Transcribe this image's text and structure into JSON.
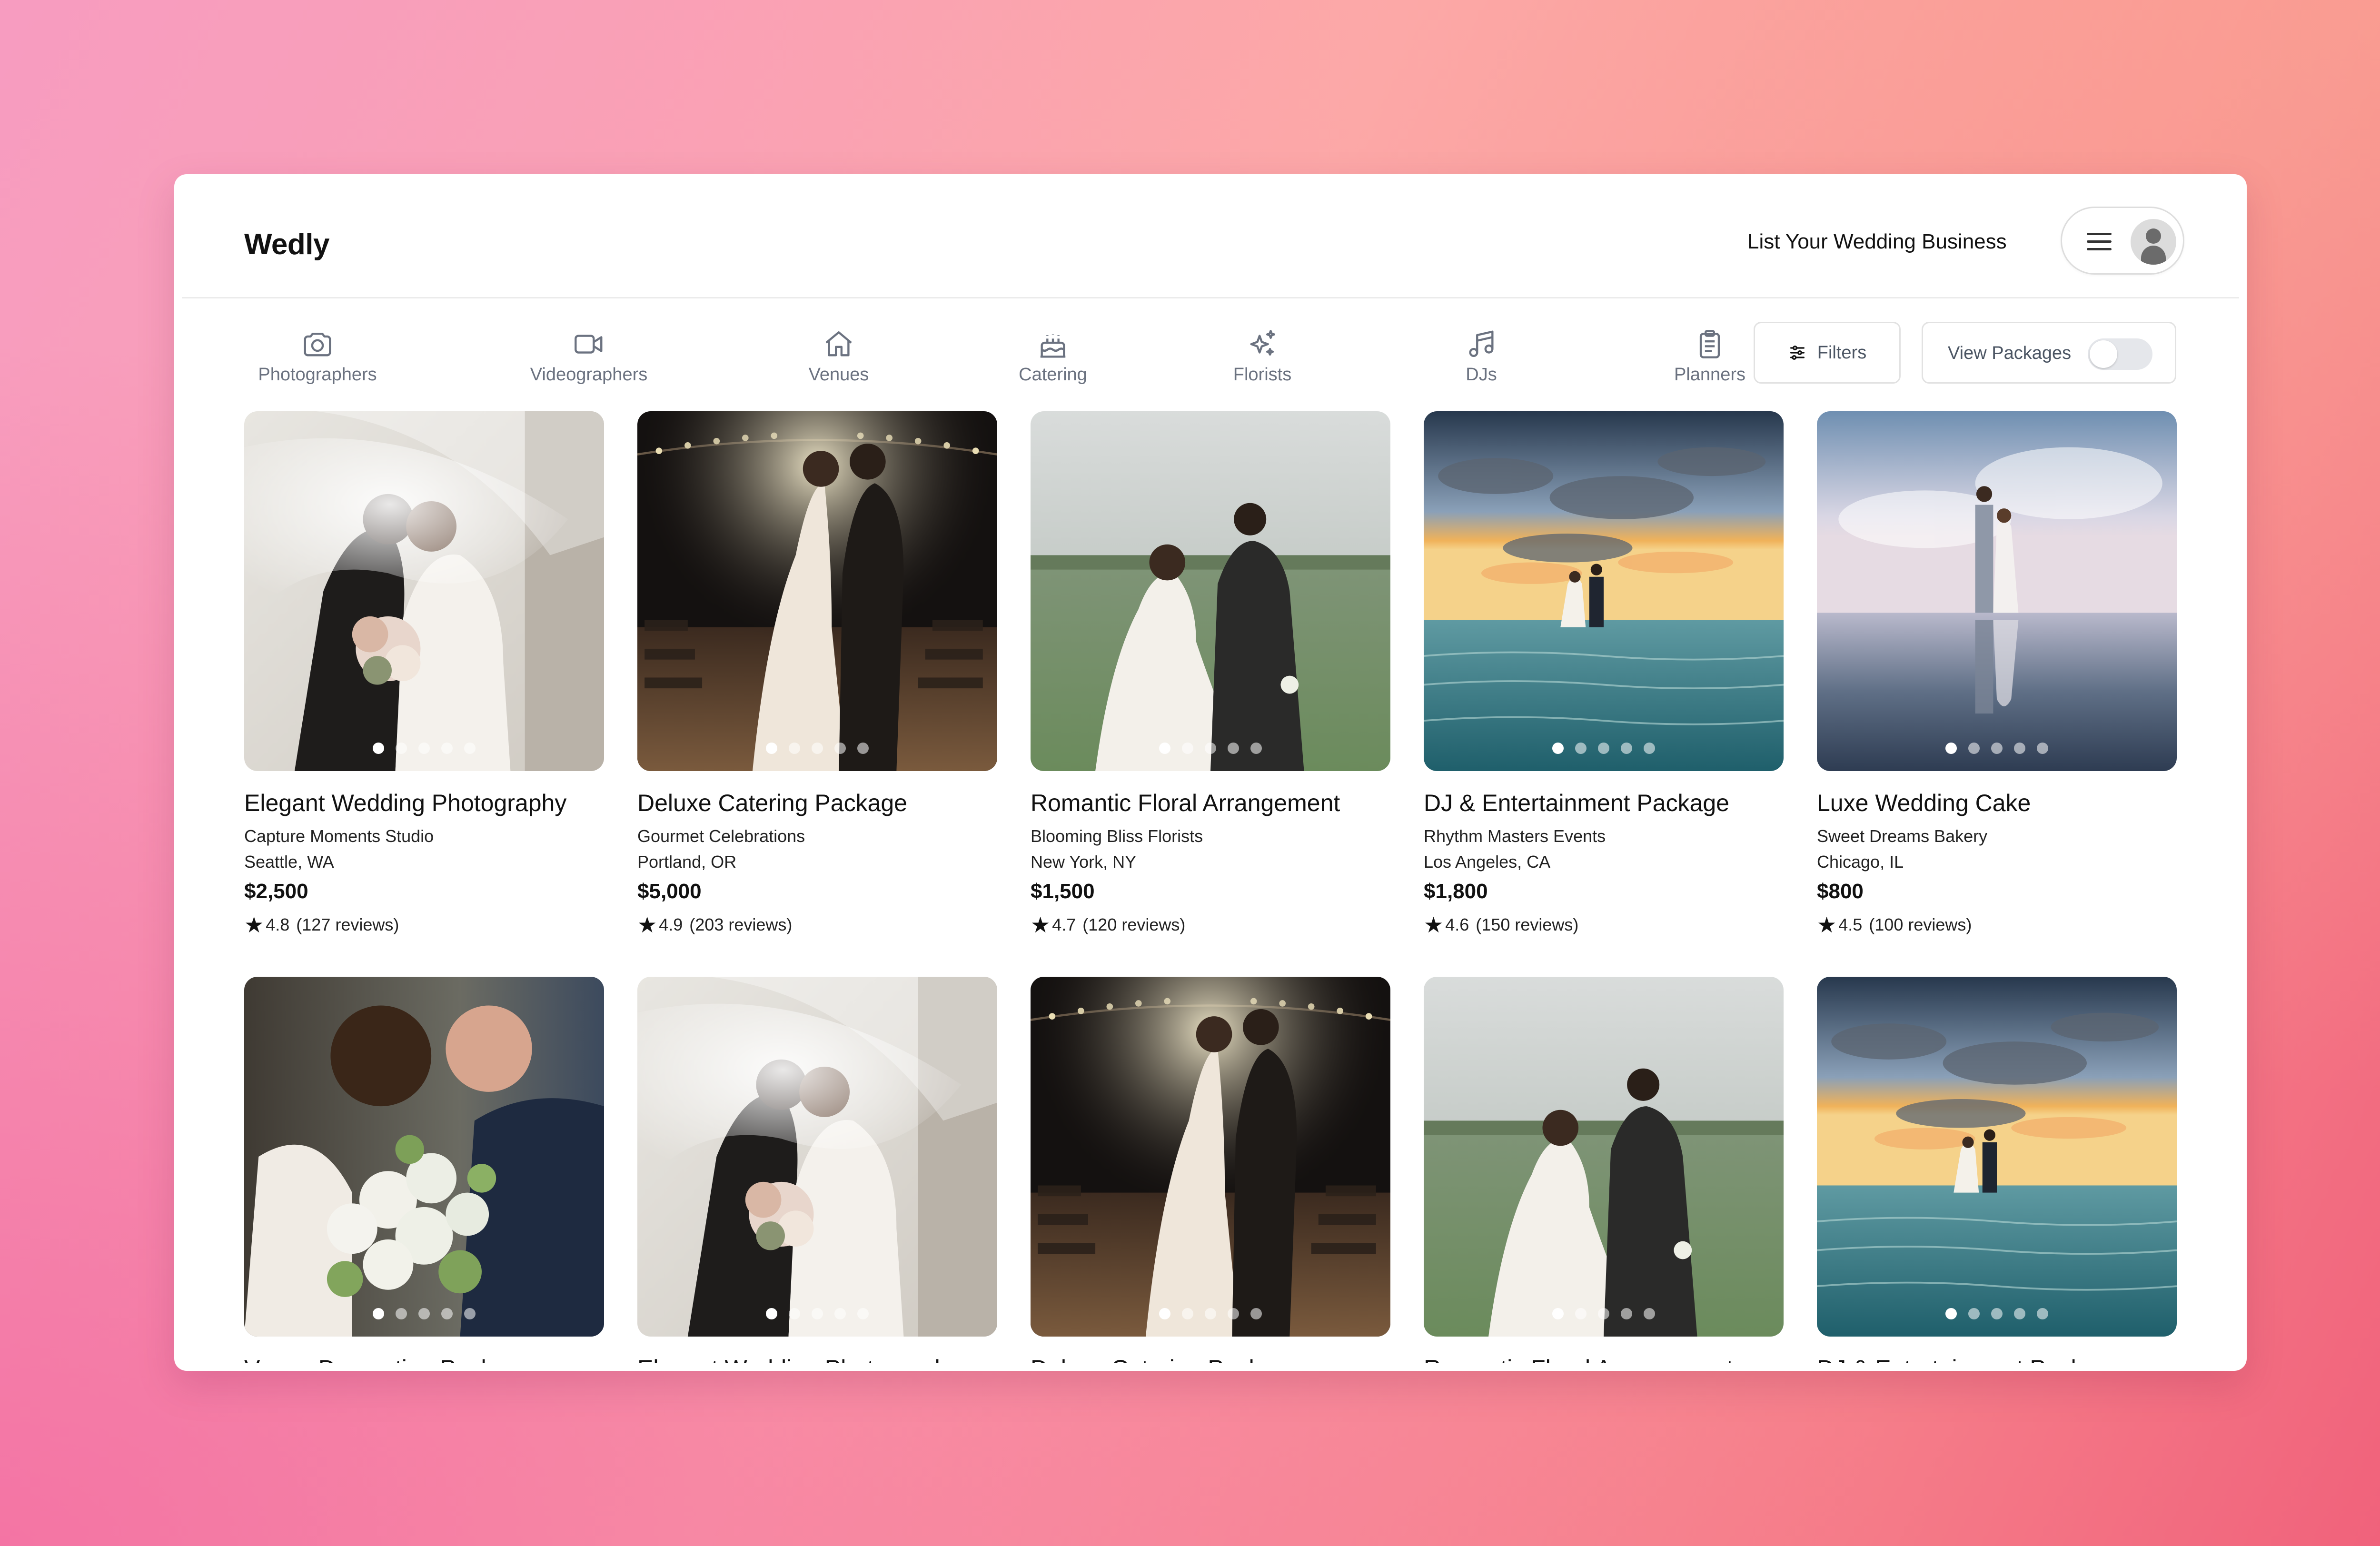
{
  "app": {
    "logo": "Wedly",
    "list_business": "List Your Wedding Business"
  },
  "user_menu": {
    "menu_icon": "hamburger-icon",
    "avatar_icon": "user-avatar-icon"
  },
  "categories": [
    {
      "label": "Photographers",
      "icon": "camera-icon"
    },
    {
      "label": "Videographers",
      "icon": "video-icon"
    },
    {
      "label": "Venues",
      "icon": "home-icon"
    },
    {
      "label": "Catering",
      "icon": "cake-icon"
    },
    {
      "label": "Florists",
      "icon": "sparkles-icon"
    },
    {
      "label": "DJs",
      "icon": "music-note-icon"
    },
    {
      "label": "Planners",
      "icon": "clipboard-icon"
    }
  ],
  "filters": {
    "label": "Filters",
    "icon": "sliders-icon"
  },
  "view_packages": {
    "label": "View Packages",
    "enabled": false
  },
  "listings": [
    {
      "title": "Elegant Wedding Photography",
      "vendor": "Capture Moments Studio",
      "location": "Seattle, WA",
      "price": "$2,500",
      "rating": "4.8",
      "reviews": "(127 reviews)",
      "image": "veil-kiss-photo",
      "active_dot": 0
    },
    {
      "title": "Deluxe Catering Package",
      "vendor": "Gourmet Celebrations",
      "location": "Portland, OR",
      "price": "$5,000",
      "rating": "4.9",
      "reviews": "(203 reviews)",
      "image": "night-venue-photo",
      "active_dot": 0
    },
    {
      "title": "Romantic Floral Arrangement",
      "vendor": "Blooming Bliss Florists",
      "location": "New York, NY",
      "price": "$1,500",
      "rating": "4.7",
      "reviews": "(120 reviews)",
      "image": "field-walk-photo",
      "active_dot": 0
    },
    {
      "title": "DJ & Entertainment Package",
      "vendor": "Rhythm Masters Events",
      "location": "Los Angeles, CA",
      "price": "$1,800",
      "rating": "4.6",
      "reviews": "(150 reviews)",
      "image": "beach-sunset-photo",
      "active_dot": 0
    },
    {
      "title": "Luxe Wedding Cake",
      "vendor": "Sweet Dreams Bakery",
      "location": "Chicago, IL",
      "price": "$800",
      "rating": "4.5",
      "reviews": "(100 reviews)",
      "image": "reflection-photo",
      "active_dot": 0
    },
    {
      "title": "Venue Decoration Package",
      "vendor": "",
      "location": "",
      "price": "",
      "rating": "",
      "reviews": "",
      "image": "bouquet-kiss-photo",
      "active_dot": 0
    },
    {
      "title": "Elegant Wedding Photography",
      "vendor": "",
      "location": "",
      "price": "",
      "rating": "",
      "reviews": "",
      "image": "veil-kiss-photo",
      "active_dot": 0
    },
    {
      "title": "Deluxe Catering Package",
      "vendor": "",
      "location": "",
      "price": "",
      "rating": "",
      "reviews": "",
      "image": "night-venue-photo",
      "active_dot": 0
    },
    {
      "title": "Romantic Floral Arrangement",
      "vendor": "",
      "location": "",
      "price": "",
      "rating": "",
      "reviews": "",
      "image": "field-walk-photo",
      "active_dot": 0
    },
    {
      "title": "DJ & Entertainment Package",
      "vendor": "",
      "location": "",
      "price": "",
      "rating": "",
      "reviews": "",
      "image": "beach-sunset-photo",
      "active_dot": 0
    }
  ],
  "dots_per_card": 5,
  "colors": {
    "accent_text": "#111111",
    "muted": "#6b7280",
    "border": "#e2e2e2"
  }
}
